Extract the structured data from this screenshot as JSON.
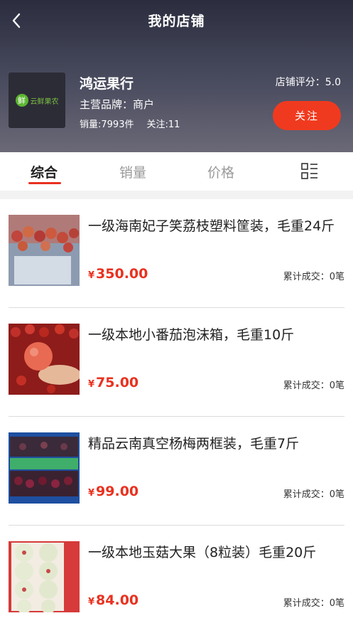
{
  "nav": {
    "title": "我的店铺"
  },
  "store": {
    "logo_text": "云鲜果农",
    "logo_mark": "鲜",
    "name": "鸿运果行",
    "brand": "主营品牌：商户",
    "sales": "销量:7993件",
    "follows": "关注:11",
    "rating": "店铺评分：5.0",
    "follow_button": "关注"
  },
  "tabs": [
    {
      "label": "综合",
      "active": true
    },
    {
      "label": "销量",
      "active": false
    },
    {
      "label": "价格",
      "active": false
    }
  ],
  "products": [
    {
      "title": "一级海南妃子笑荔枝塑料筐装，毛重24斤",
      "currency": "¥",
      "price": "350.00",
      "deals": "累计成交：0笔"
    },
    {
      "title": "一级本地小番茄泡沫箱，毛重10斤",
      "currency": "¥",
      "price": "75.00",
      "deals": "累计成交：0笔"
    },
    {
      "title": "精品云南真空杨梅两框装，毛重7斤",
      "currency": "¥",
      "price": "99.00",
      "deals": "累计成交：0笔"
    },
    {
      "title": "一级本地玉菇大果（8粒装）毛重20斤",
      "currency": "¥",
      "price": "84.00",
      "deals": "累计成交：0笔"
    }
  ],
  "colors": {
    "accent": "#e9311f",
    "follow_button": "#f03a1f",
    "header_dark": "#2b2d3f"
  }
}
